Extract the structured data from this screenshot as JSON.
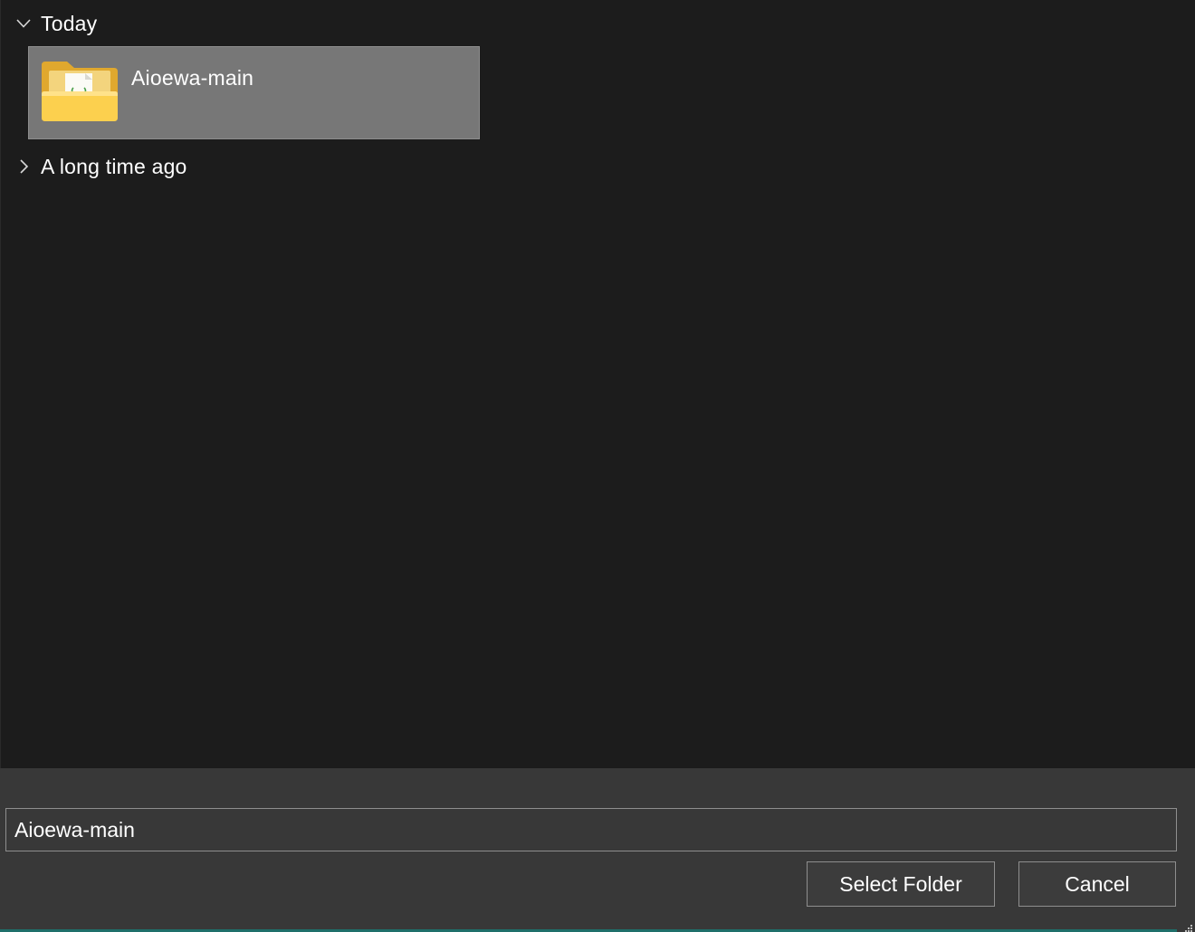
{
  "groups": {
    "today": {
      "label": "Today",
      "expanded": true,
      "icon": "chevron-down-icon"
    },
    "older": {
      "label": "A long time ago",
      "expanded": false,
      "icon": "chevron-right-icon"
    }
  },
  "items": [
    {
      "name": "Aioewa-main",
      "icon": "folder-icon",
      "selected": true
    }
  ],
  "footer": {
    "folder_name_value": "Aioewa-main",
    "select_button_label": "Select Folder",
    "cancel_button_label": "Cancel"
  },
  "colors": {
    "background": "#1c1c1c",
    "selection": "#777777",
    "footer": "#383838",
    "folder": "#f6c44f",
    "accent": "#1f6f6a"
  }
}
